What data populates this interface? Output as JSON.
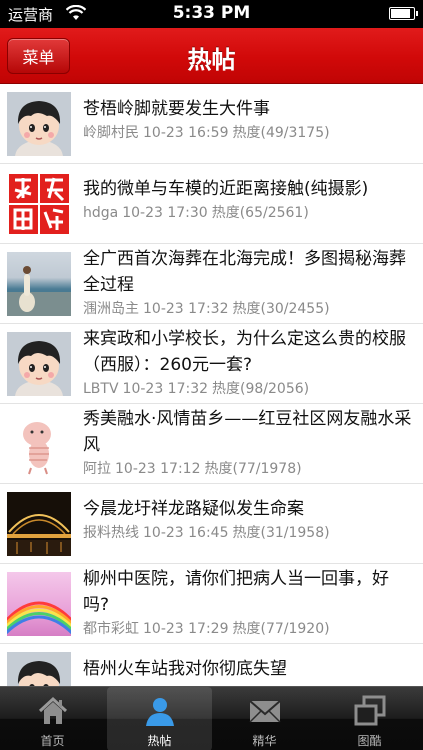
{
  "status_bar": {
    "carrier": "运营商",
    "time": "5:33 PM"
  },
  "nav": {
    "menu_label": "菜单",
    "title": "热帖"
  },
  "posts": [
    {
      "title": "苍梧岭脚就要发生大件事",
      "author": "岭脚村民",
      "time": "10-23 16:59",
      "heat": "热度(49/3175)",
      "thumb": "cartoon-avatar"
    },
    {
      "title": "我的微单与车模的近距离接触(纯摄影)",
      "author": "hdga",
      "time": "10-23 17:30",
      "heat": "热度(65/2561)",
      "thumb": "red-seal-logo"
    },
    {
      "title": "全广西首次海葬在北海完成！多图揭秘海葬全过程",
      "author": "涠洲岛主",
      "time": "10-23 17:32",
      "heat": "热度(30/2455)",
      "thumb": "seaside-photo"
    },
    {
      "title": "来宾政和小学校长，为什么定这么贵的校服（西服）：260元一套?",
      "author": "LBTV",
      "time": "10-23 17:32",
      "heat": "热度(98/2056)",
      "thumb": "cartoon-avatar"
    },
    {
      "title": "秀美融水·风情苗乡——红豆社区网友融水采风",
      "author": "阿拉",
      "time": "10-23 17:12",
      "heat": "热度(77/1978)",
      "thumb": "pig-sketch"
    },
    {
      "title": "今晨龙圩祥龙路疑似发生命案",
      "author": "报料热线",
      "time": "10-23 16:45",
      "heat": "热度(31/1958)",
      "thumb": "night-bridge"
    },
    {
      "title": "柳州中医院，请你们把病人当一回事，好吗?",
      "author": "都市彩虹",
      "time": "10-23 17:29",
      "heat": "热度(77/1920)",
      "thumb": "rainbow"
    },
    {
      "title": "梧州火车站我对你彻底失望",
      "author": "",
      "time": "",
      "heat": "",
      "thumb": "cartoon-avatar"
    }
  ],
  "tabs": [
    {
      "label": "首页",
      "icon": "home-icon"
    },
    {
      "label": "热帖",
      "icon": "person-icon",
      "active": true
    },
    {
      "label": "精华",
      "icon": "envelope-icon"
    },
    {
      "label": "图酷",
      "icon": "gallery-icon"
    }
  ],
  "colors": {
    "nav_red": "#d10909",
    "meta_gray": "#8a8a8a",
    "tab_dark": "#1c1c1c",
    "active_tab_icon": "#3a9ae8"
  }
}
